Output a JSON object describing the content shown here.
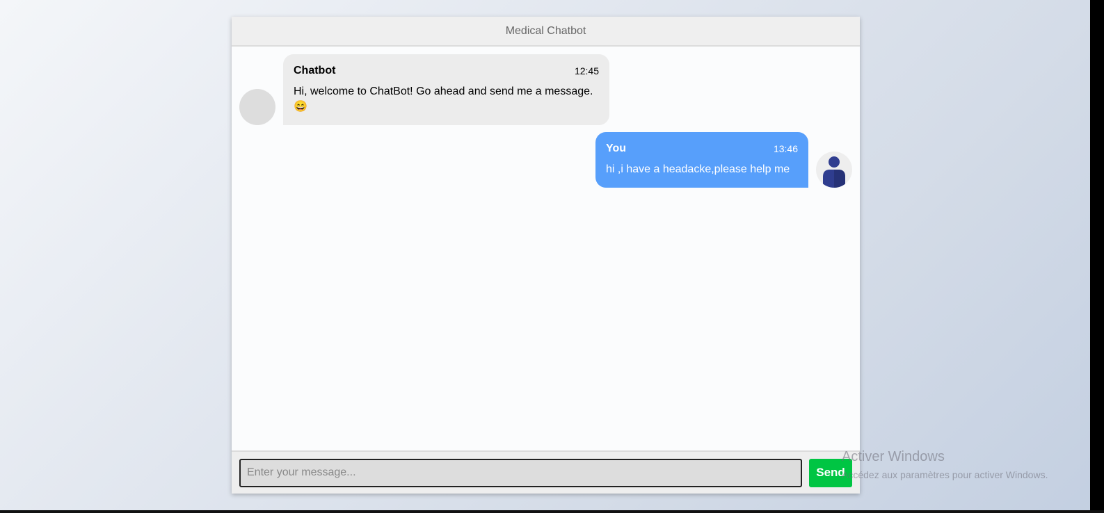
{
  "header": {
    "title": "Medical Chatbot"
  },
  "messages": [
    {
      "name": "Chatbot",
      "time": "12:45",
      "text": "Hi, welcome to ChatBot! Go ahead and send me a message. 😄"
    },
    {
      "name": "You",
      "time": "13:46",
      "text": "hi ,i have a headacke,please help me"
    }
  ],
  "input": {
    "placeholder": "Enter your message...",
    "send_label": "Send"
  },
  "watermark": {
    "title": "Activer Windows",
    "subtitle": "Accédez aux paramètres pour activer Windows."
  },
  "colors": {
    "bot_bubble": "#ececec",
    "user_bubble": "#579ffb",
    "send_button": "#00c543",
    "user_avatar": "#2f3d8f"
  },
  "icons": {
    "user_avatar": "person-icon"
  }
}
